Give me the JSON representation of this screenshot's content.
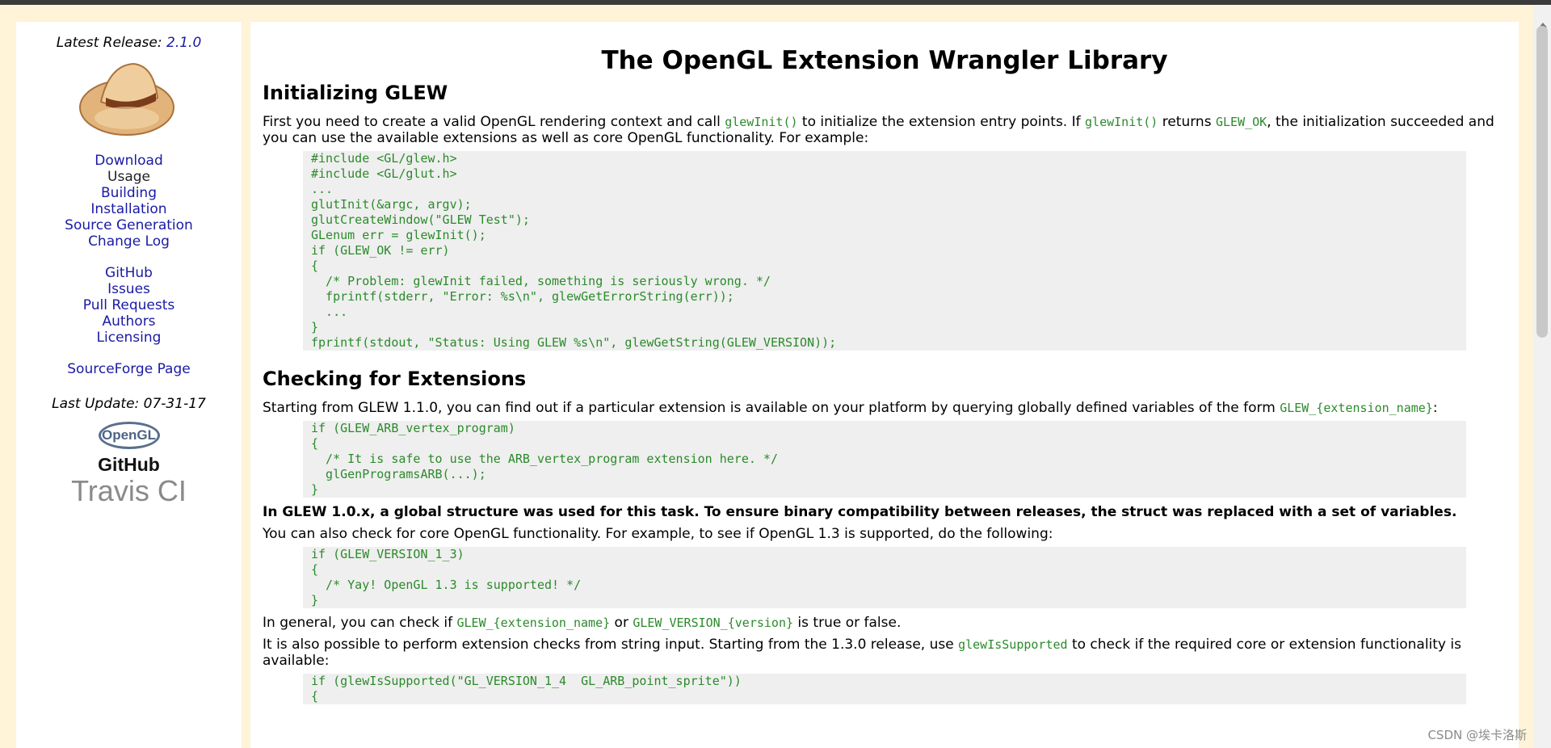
{
  "sidebar": {
    "release_label": "Latest Release:",
    "release_version": "2.1.0",
    "nav_group1": [
      "Download",
      "Usage",
      "Building",
      "Installation",
      "Source Generation",
      "Change Log"
    ],
    "nav_group2": [
      "GitHub",
      "Issues",
      "Pull Requests",
      "Authors",
      "Licensing"
    ],
    "nav_group3": [
      "SourceForge Page"
    ],
    "last_update": "Last Update: 07-31-17",
    "badges": {
      "opengl": "OpenGL",
      "github": "GitHub",
      "travis": "Travis CI"
    }
  },
  "main": {
    "title": "The OpenGL Extension Wrangler Library",
    "section1": {
      "heading": "Initializing GLEW",
      "p1_a": "First you need to create a valid OpenGL rendering context and call ",
      "p1_code1": "glewInit()",
      "p1_b": " to initialize the extension entry points. If ",
      "p1_code2": "glewInit()",
      "p1_c": " returns ",
      "p1_code3": "GLEW_OK",
      "p1_d": ", the initialization succeeded and you can use the available extensions as well as core OpenGL functionality. For example:",
      "code": [
        "#include <GL/glew.h>",
        "#include <GL/glut.h>",
        "...",
        "glutInit(&argc, argv);",
        "glutCreateWindow(\"GLEW Test\");",
        "GLenum err = glewInit();",
        "if (GLEW_OK != err)",
        "{",
        "  /* Problem: glewInit failed, something is seriously wrong. */",
        "  fprintf(stderr, \"Error: %s\\n\", glewGetErrorString(err));",
        "  ...",
        "}",
        "fprintf(stdout, \"Status: Using GLEW %s\\n\", glewGetString(GLEW_VERSION));"
      ]
    },
    "section2": {
      "heading": "Checking for Extensions",
      "p1_a": "Starting from GLEW 1.1.0, you can find out if a particular extension is available on your platform by querying globally defined variables of the form ",
      "p1_code": "GLEW_{extension_name}",
      "p1_b": ":",
      "code1": [
        "if (GLEW_ARB_vertex_program)",
        "{",
        "  /* It is safe to use the ARB_vertex_program extension here. */",
        "  glGenProgramsARB(...);",
        "}"
      ],
      "bold_note": "In GLEW 1.0.x, a global structure was used for this task. To ensure binary compatibility between releases, the struct was replaced with a set of variables.",
      "p2": "You can also check for core OpenGL functionality. For example, to see if OpenGL 1.3 is supported, do the following:",
      "code2": [
        "if (GLEW_VERSION_1_3)",
        "{",
        "  /* Yay! OpenGL 1.3 is supported! */",
        "}"
      ],
      "p3_a": "In general, you can check if ",
      "p3_code1": "GLEW_{extension_name}",
      "p3_b": " or ",
      "p3_code2": "GLEW_VERSION_{version}",
      "p3_c": " is true or false.",
      "p4_a": "It is also possible to perform extension checks from string input. Starting from the 1.3.0 release, use ",
      "p4_code": "glewIsSupported",
      "p4_b": " to check if the required core or extension functionality is available:",
      "code3": [
        "if (glewIsSupported(\"GL_VERSION_1_4  GL_ARB_point_sprite\"))",
        "{"
      ]
    }
  },
  "watermark": "CSDN @埃卡洛斯"
}
